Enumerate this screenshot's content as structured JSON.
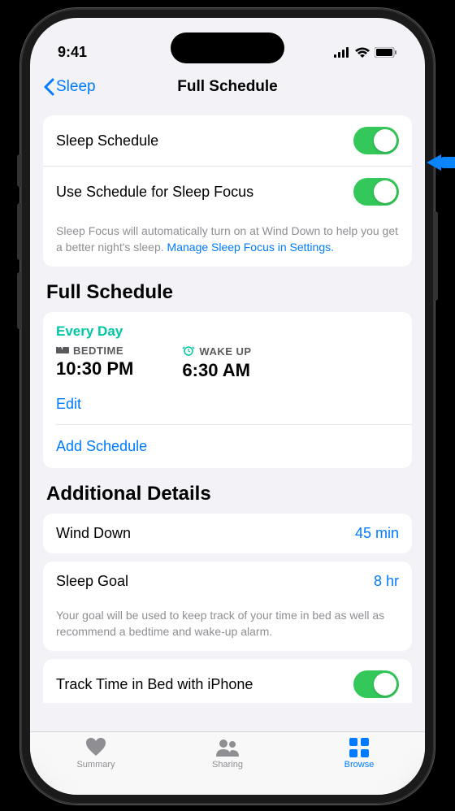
{
  "status": {
    "time": "9:41"
  },
  "nav": {
    "back_label": "Sleep",
    "title": "Full Schedule"
  },
  "toggles": {
    "schedule_label": "Sleep Schedule",
    "focus_label": "Use Schedule for Sleep Focus",
    "footer_text": "Sleep Focus will automatically turn on at Wind Down to help you get a better night's sleep. ",
    "footer_link": "Manage Sleep Focus in Settings."
  },
  "schedule": {
    "section_title": "Full Schedule",
    "days_label": "Every Day",
    "bedtime_label": "BEDTIME",
    "bedtime_value": "10:30 PM",
    "wakeup_label": "WAKE UP",
    "wakeup_value": "6:30 AM",
    "edit_label": "Edit",
    "add_label": "Add Schedule"
  },
  "details": {
    "section_title": "Additional Details",
    "wind_down_label": "Wind Down",
    "wind_down_value": "45 min",
    "sleep_goal_label": "Sleep Goal",
    "sleep_goal_value": "8 hr",
    "goal_footer": "Your goal will be used to keep track of your time in bed as well as recommend a bedtime and wake-up alarm.",
    "track_label": "Track Time in Bed with iPhone"
  },
  "tabs": {
    "summary": "Summary",
    "sharing": "Sharing",
    "browse": "Browse"
  }
}
